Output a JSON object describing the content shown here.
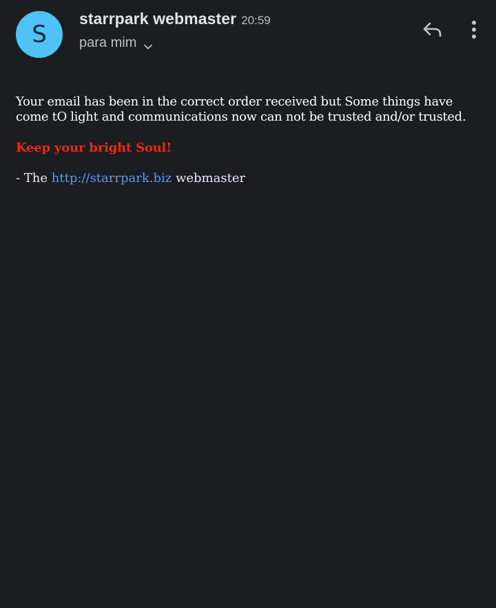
{
  "header": {
    "avatar_letter": "S",
    "avatar_color": "#4fc3f7",
    "sender_name": "starrpark webmaster",
    "time": "20:59",
    "recipient": "para mim",
    "recipient_toggle_icon": "chevron-down-icon",
    "reply_icon": "reply-icon",
    "more_icon": "more-vert-icon"
  },
  "body": {
    "paragraph_main": "Your email has been in the correct order received but Some things have come tO light and communications now can not be trusted and/or trusted.",
    "highlight_text": "Keep your bright Soul!",
    "highlight_color": "#ea2a12",
    "signature_prefix": "- The",
    "signature_link": "http://starrpark.biz",
    "signature_link_color": "#5b9bf0",
    "signature_suffix": "webmaster"
  }
}
